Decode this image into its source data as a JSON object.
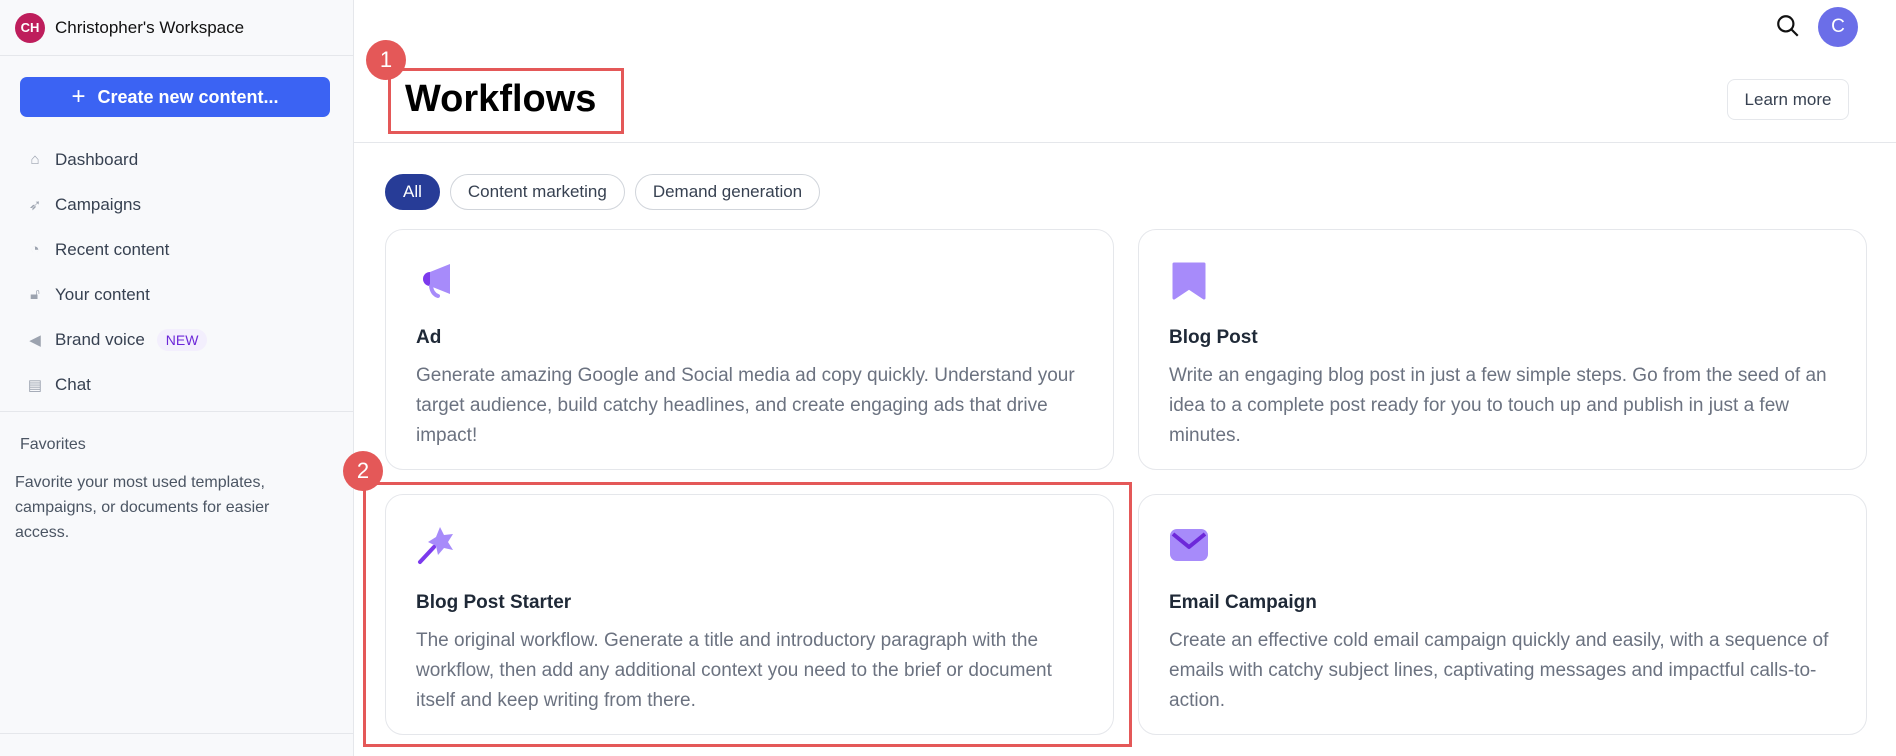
{
  "sidebar": {
    "workspace_initials": "CH",
    "workspace_name": "Christopher's Workspace",
    "create_button": "Create new content...",
    "items": [
      {
        "label": "Dashboard",
        "icon": "home-icon"
      },
      {
        "label": "Campaigns",
        "icon": "rocket-icon"
      },
      {
        "label": "Recent content",
        "icon": "clock-icon"
      },
      {
        "label": "Your content",
        "icon": "lock-icon"
      },
      {
        "label": "Brand voice",
        "icon": "megaphone-icon",
        "badge": "NEW"
      },
      {
        "label": "Chat",
        "icon": "chat-icon"
      }
    ],
    "favorites_title": "Favorites",
    "favorites_text": "Favorite your most used templates, campaigns, or documents for easier access."
  },
  "header": {
    "title": "Workflows",
    "learn_more": "Learn more",
    "user_initial": "C"
  },
  "filters": [
    "All",
    "Content marketing",
    "Demand generation"
  ],
  "cards": [
    {
      "title": "Ad",
      "icon": "megaphone-icon",
      "description": "Generate amazing Google and Social media ad copy quickly. Understand your target audience, build catchy headlines, and create engaging ads that drive impact!"
    },
    {
      "title": "Blog Post",
      "icon": "bookmark-icon",
      "description": "Write an engaging blog post in just a few simple steps. Go from the seed of an idea to a complete post ready for you to touch up and publish in just a few minutes."
    },
    {
      "title": "Blog Post Starter",
      "icon": "magic-wand-icon",
      "description": "The original workflow. Generate a title and introductory paragraph with the workflow, then add any additional context you need to the brief or document itself and keep writing from there."
    },
    {
      "title": "Email Campaign",
      "icon": "envelope-icon",
      "description": "Create an effective cold email campaign quickly and easily, with a sequence of emails with catchy subject lines, captivating messages and impactful calls-to-action."
    }
  ],
  "annotations": [
    "1",
    "2"
  ],
  "colors": {
    "primary": "#3b63f3",
    "active_pill": "#273c97",
    "icon_purple": "#a78bfa",
    "annotation": "#e45858"
  }
}
